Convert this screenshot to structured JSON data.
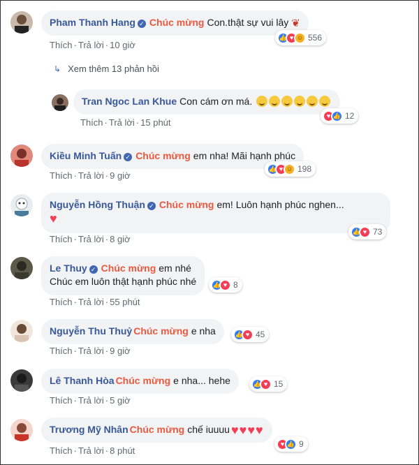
{
  "actions": {
    "like": "Thích",
    "reply": "Trả lời"
  },
  "tag": "Chúc mừng",
  "more_replies": "Xem thêm 13 phản hồi",
  "comments": [
    {
      "name": "Pham Thanh Hang",
      "text": "Con.thật sự vui lây",
      "time": "10 giờ",
      "reactions": 556
    },
    {
      "name": "Tran Ngoc Lan Khue",
      "text": "Con cám ơn má.",
      "time": "15 phút",
      "reactions": 12
    },
    {
      "name": "Kiều Minh Tuấn",
      "text": "em nha! Mãi hạnh phúc",
      "time": "9 giờ",
      "reactions": 198
    },
    {
      "name": "Nguyễn Hồng Thuận",
      "text": "em! Luôn hạnh phúc nghen...",
      "time": "8 giờ",
      "reactions": 73
    },
    {
      "name": "Le Thuy",
      "text": "em nhé",
      "text2": "Chúc em luôn thật hạnh phúc nhé",
      "time": "55 phút",
      "reactions": 8
    },
    {
      "name": "Nguyễn Thu Thuỷ",
      "text": "e nha",
      "time": "9 giờ",
      "reactions": 45
    },
    {
      "name": "Lê Thanh Hòa",
      "text": "e nha... hehe",
      "time": "5 giờ",
      "reactions": 15
    },
    {
      "name": "Trương Mỹ Nhân",
      "text": "chế iuuuu",
      "time": "8 phút",
      "reactions": 9
    }
  ],
  "colors": {
    "name": "#385898",
    "tag": "#e9593f",
    "bubble": "#f2f3f5",
    "like": "#2e7cf6",
    "love": "#f33e58",
    "haha": "#f7b125"
  },
  "icons": [
    "like-reaction-icon",
    "love-reaction-icon",
    "haha-reaction-icon",
    "verified-badge-icon",
    "reply-arrow-icon",
    "smile-emoji-icon",
    "heart-emoji-icon",
    "rose-emoji-icon"
  ]
}
